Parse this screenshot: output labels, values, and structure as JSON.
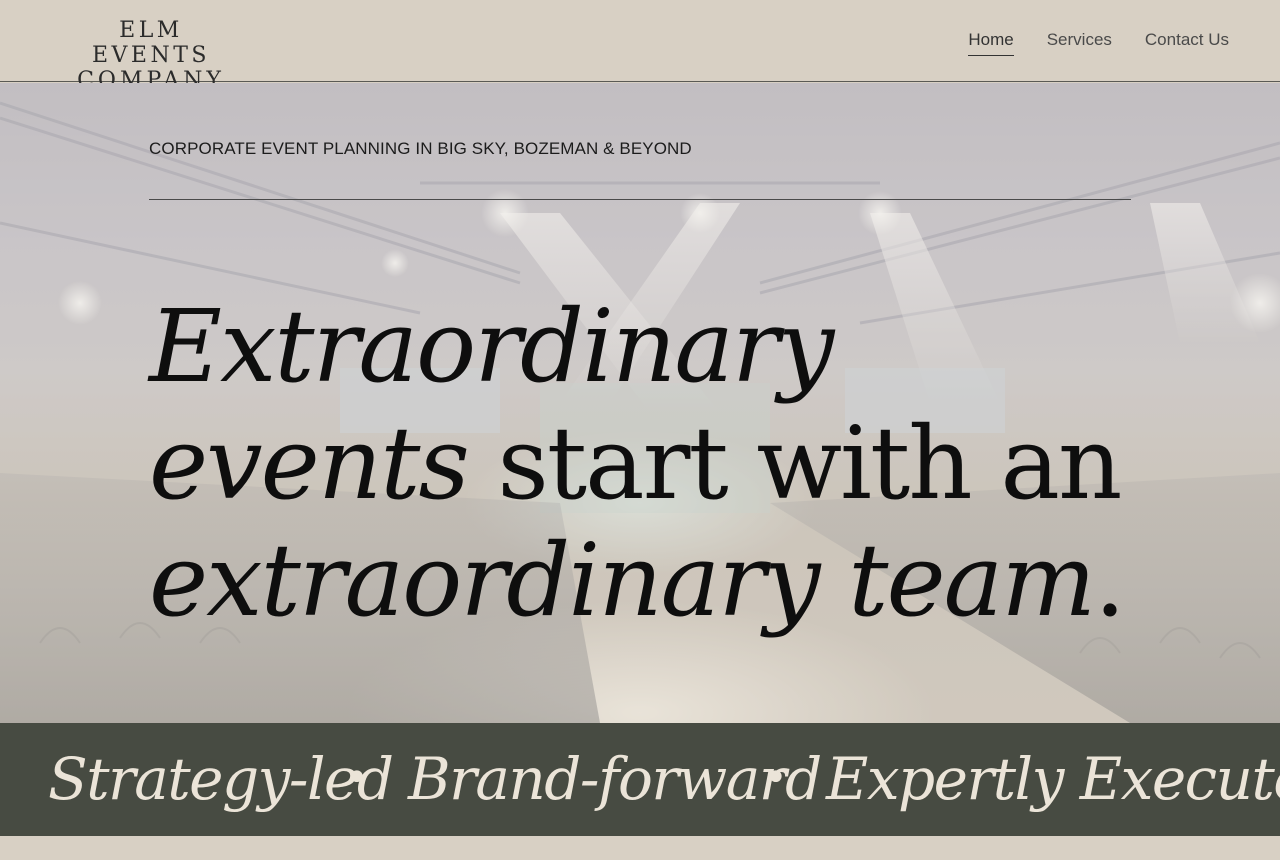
{
  "logo": {
    "line1": "ELM EVENTS",
    "line2": "COMPANY"
  },
  "nav": {
    "items": [
      {
        "label": "Home",
        "active": true
      },
      {
        "label": "Services",
        "active": false
      },
      {
        "label": "Contact Us",
        "active": false
      }
    ]
  },
  "hero": {
    "eyebrow": "CORPORATE EVENT PLANNING IN BIG SKY, BOZEMAN & BEYOND",
    "headline": {
      "part1_italic": "Extraordinary events",
      "part2": " start with an ",
      "part3_italic": "extraordinary team",
      "part4": "."
    }
  },
  "banner": {
    "items": [
      "Strategy-led",
      "Brand-forward",
      "Expertly Executed"
    ],
    "separator": "•"
  },
  "colors": {
    "background": "#d8d0c4",
    "banner": "#474b42",
    "banner_text": "#ebe4d8",
    "headline": "#0e0e0e"
  }
}
